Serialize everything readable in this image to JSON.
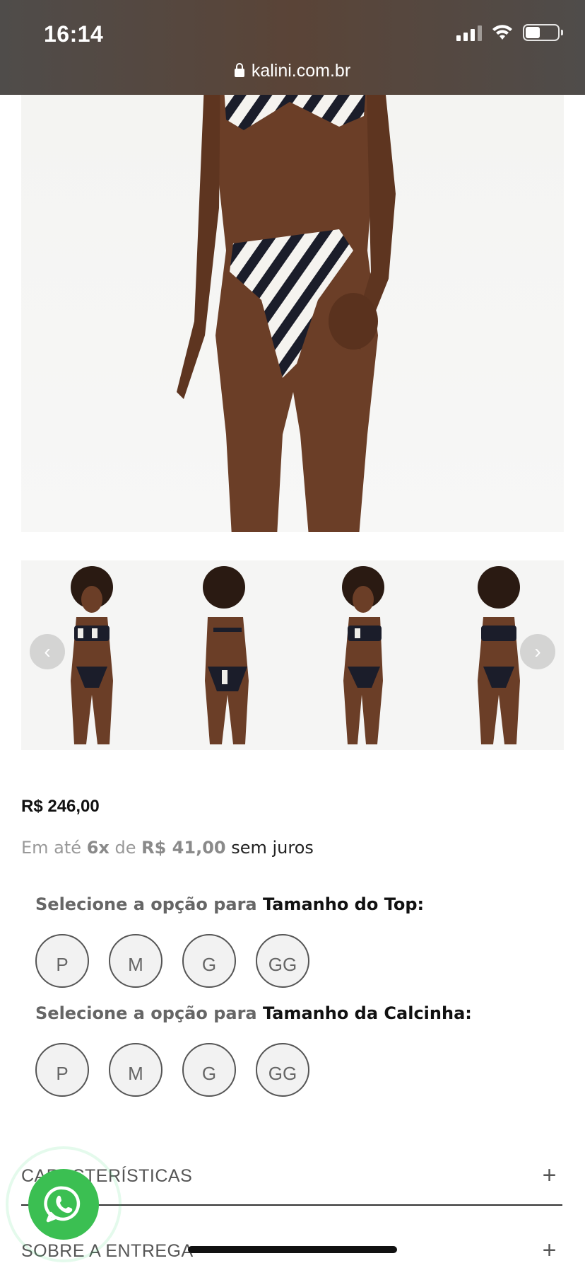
{
  "status_bar": {
    "time": "16:14"
  },
  "browser": {
    "url": "kalini.com.br"
  },
  "gallery": {
    "main_image_alt": "",
    "thumbnail_count": 4
  },
  "product": {
    "price": "R$ 246,00",
    "installments": {
      "prefix": "Em até ",
      "count": "6x",
      "middle": " de ",
      "amount": "R$ 41,00",
      "suffix": " sem juros"
    }
  },
  "options": [
    {
      "label_prefix": "Selecione a opção para ",
      "label_name": "Tamanho do Top:",
      "sizes": [
        "P",
        "M",
        "G",
        "GG"
      ]
    },
    {
      "label_prefix": "Selecione a opção para ",
      "label_name": "Tamanho da Calcinha:",
      "sizes": [
        "P",
        "M",
        "G",
        "GG"
      ]
    }
  ],
  "accordions": [
    {
      "label": "CARACTERÍSTICAS",
      "icon": "plus-icon"
    },
    {
      "label": "SOBRE A ENTREGA",
      "icon": "plus-icon"
    }
  ],
  "colors": {
    "whatsapp": "#3bbf52",
    "topbar": "#4f4c4a"
  }
}
